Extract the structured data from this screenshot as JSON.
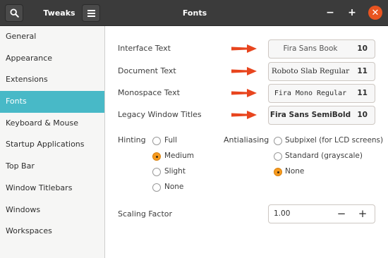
{
  "header": {
    "left_title": "Tweaks",
    "title": "Fonts",
    "minimize_glyph": "−",
    "maximize_glyph": "+",
    "close_glyph": "✕"
  },
  "sidebar": {
    "items": [
      {
        "label": "General"
      },
      {
        "label": "Appearance"
      },
      {
        "label": "Extensions"
      },
      {
        "label": "Fonts",
        "active": true
      },
      {
        "label": "Keyboard & Mouse"
      },
      {
        "label": "Startup Applications"
      },
      {
        "label": "Top Bar"
      },
      {
        "label": "Window Titlebars"
      },
      {
        "label": "Windows"
      },
      {
        "label": "Workspaces"
      }
    ]
  },
  "fonts": {
    "interface": {
      "label": "Interface Text",
      "name": "Fira Sans Book",
      "size": "10"
    },
    "document": {
      "label": "Document Text",
      "name": "Roboto Slab Regular",
      "size": "11"
    },
    "monospace": {
      "label": "Monospace Text",
      "name": "Fira Mono Regular",
      "size": "11"
    },
    "legacy": {
      "label": "Legacy Window Titles",
      "name": "Fira Sans SemiBold",
      "size": "10"
    }
  },
  "hinting": {
    "label": "Hinting",
    "options": [
      "Full",
      "Medium",
      "Slight",
      "None"
    ],
    "selected": "Medium"
  },
  "antialiasing": {
    "label": "Antialiasing",
    "options": [
      "Subpixel (for LCD screens)",
      "Standard (grayscale)",
      "None"
    ],
    "selected": "None"
  },
  "scaling": {
    "label": "Scaling Factor",
    "value": "1.00",
    "decrement": "−",
    "increment": "+"
  },
  "colors": {
    "accent": "#48b9c7",
    "radio_on": "#f79a1e",
    "close": "#e95420",
    "arrow": "#e8451e",
    "header_bg": "#3b3b3b"
  }
}
